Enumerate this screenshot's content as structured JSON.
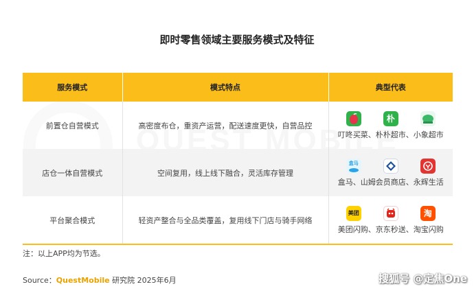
{
  "title": "即时零售领域主要服务模式及特征",
  "watermark": "QUEST MOBILE",
  "headers": [
    "服务模式",
    "模式特点",
    "典型代表"
  ],
  "rows": [
    {
      "mode": "前置仓自营模式",
      "feature": "高密度布仓，重资产运营，配送速度更快，自营品控",
      "reps": "叮咚买菜、朴朴超市、小象超市",
      "icons": [
        {
          "name": "dingdong-icon",
          "glyph": "",
          "color": "#2fb24a"
        },
        {
          "name": "pupu-icon",
          "glyph": "朴",
          "color": "#2fb24a"
        },
        {
          "name": "xiaoxiang-icon",
          "glyph": "",
          "color": "#35b36a"
        }
      ]
    },
    {
      "mode": "店仓一体自营模式",
      "feature": "空间复用，线上线下融合，灵活库存管理",
      "reps": "盒马、山姆会员商店、永辉生活",
      "icons": [
        {
          "name": "hema-icon",
          "glyph": "盒马",
          "color": "#2aa4e6"
        },
        {
          "name": "sams-icon",
          "glyph": "S",
          "color": "#1b4f9a"
        },
        {
          "name": "yonghui-icon",
          "glyph": "Y",
          "color": "#e23431"
        }
      ]
    },
    {
      "mode": "平台聚合模式",
      "feature": "轻资产整合与全品类覆盖，复用线下门店与骑手网络",
      "reps": "美团闪购、京东秒送、淘宝闪购",
      "icons": [
        {
          "name": "meituan-icon",
          "glyph": "美团",
          "color": "#ffd100"
        },
        {
          "name": "jd-icon",
          "glyph": "",
          "color": "#e1251b"
        },
        {
          "name": "taobao-icon",
          "glyph": "淘",
          "color": "#ff5000"
        }
      ]
    }
  ],
  "note": "注：以上APP均为节选。",
  "source": {
    "prefix": "Source：",
    "brand": "QuestMobile",
    "suffix": " 研究院 2025年6月"
  },
  "credit": "搜狐号 @定焦One"
}
